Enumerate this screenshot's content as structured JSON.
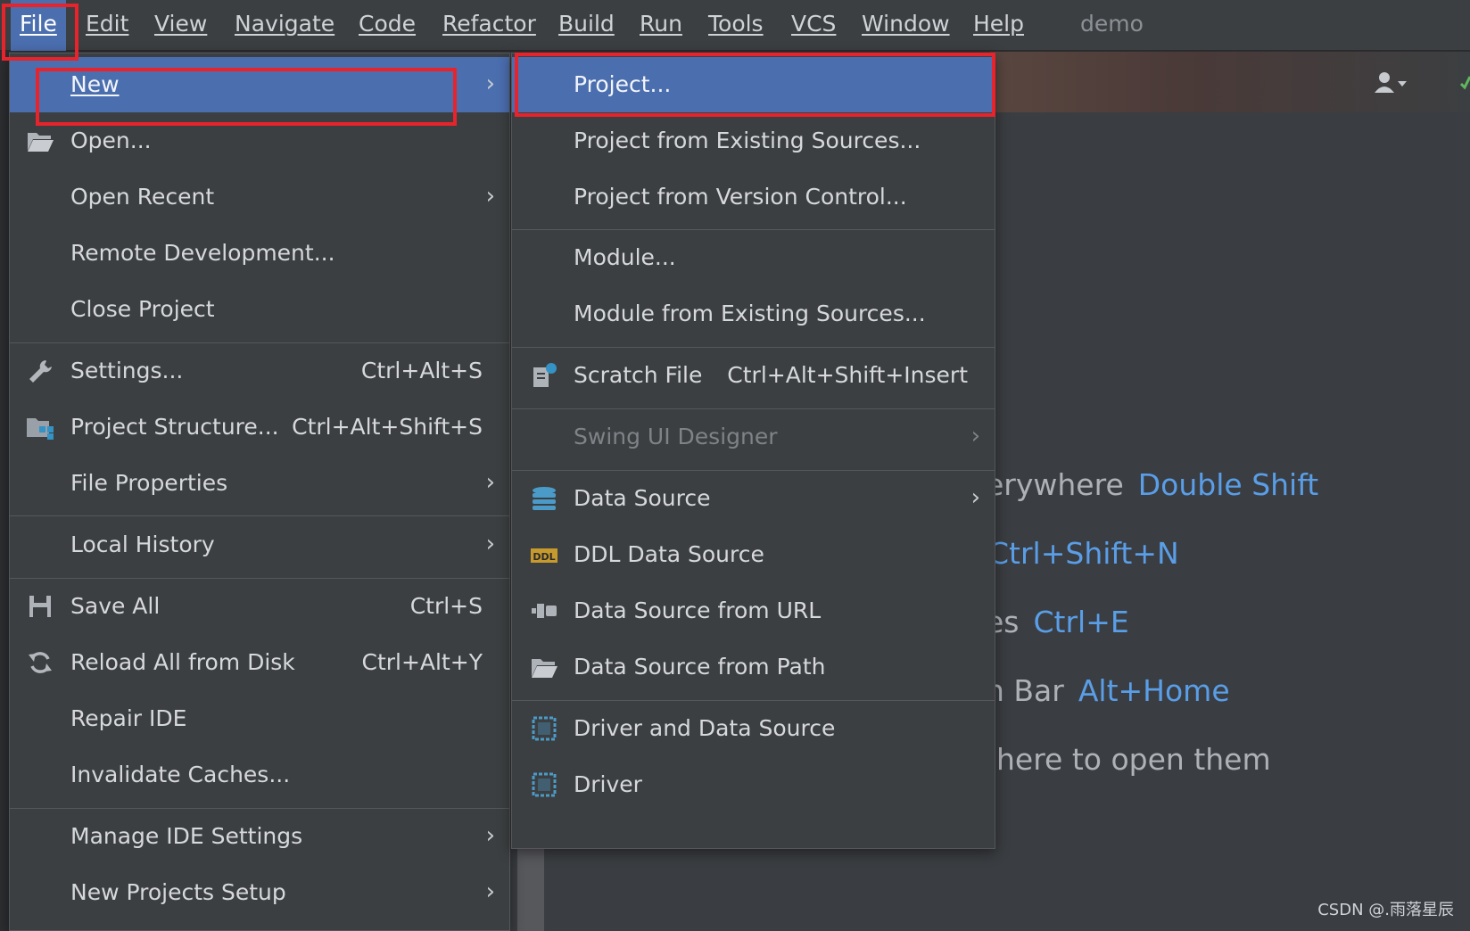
{
  "menubar": {
    "items": [
      {
        "label": "File"
      },
      {
        "label": "Edit"
      },
      {
        "label": "View"
      },
      {
        "label": "Navigate"
      },
      {
        "label": "Code"
      },
      {
        "label": "Refactor"
      },
      {
        "label": "Build"
      },
      {
        "label": "Run"
      },
      {
        "label": "Tools"
      },
      {
        "label": "VCS"
      },
      {
        "label": "Window"
      },
      {
        "label": "Help"
      }
    ],
    "project_name": "demo"
  },
  "file_menu": {
    "new": "New",
    "open": "Open...",
    "open_recent": "Open Recent",
    "remote_development": "Remote Development...",
    "close_project": "Close Project",
    "settings": "Settings...",
    "settings_shortcut": "Ctrl+Alt+S",
    "project_structure": "Project Structure...",
    "project_structure_shortcut": "Ctrl+Alt+Shift+S",
    "file_properties": "File Properties",
    "local_history": "Local History",
    "save_all": "Save All",
    "save_all_shortcut": "Ctrl+S",
    "reload_all": "Reload All from Disk",
    "reload_all_shortcut": "Ctrl+Alt+Y",
    "repair_ide": "Repair IDE",
    "invalidate_caches": "Invalidate Caches...",
    "manage_ide_settings": "Manage IDE Settings",
    "new_projects_setup": "New Projects Setup"
  },
  "new_menu": {
    "project": "Project...",
    "project_existing": "Project from Existing Sources...",
    "project_vcs": "Project from Version Control...",
    "module": "Module...",
    "module_existing": "Module from Existing Sources...",
    "scratch_file": "Scratch File",
    "scratch_file_shortcut": "Ctrl+Alt+Shift+Insert",
    "swing_ui_designer": "Swing UI Designer",
    "data_source": "Data Source",
    "ddl_data_source": "DDL Data Source",
    "data_source_url": "Data Source from URL",
    "data_source_path": "Data Source from Path",
    "driver_and_data_source": "Driver and Data Source",
    "driver": "Driver"
  },
  "welcome_hints": [
    {
      "text": "erywhere",
      "key": "Double Shift"
    },
    {
      "text": "",
      "key": "Ctrl+Shift+N"
    },
    {
      "text": "es",
      "key": "Ctrl+E"
    },
    {
      "text": "n Bar",
      "key": "Alt+Home"
    },
    {
      "text": "here to open them",
      "key": ""
    }
  ],
  "watermark": "CSDN @.雨落星辰",
  "colors": {
    "selection": "#4b6eaf",
    "menu_bg": "#3c3f41",
    "highlight_box": "#e8232b",
    "shortcut_link": "#5a9ee8"
  }
}
